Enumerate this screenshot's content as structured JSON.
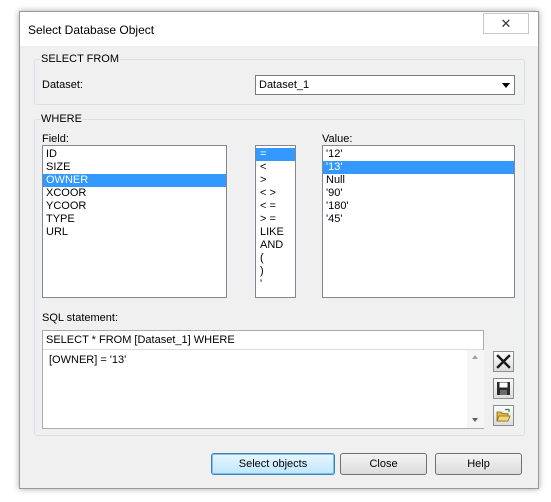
{
  "window": {
    "title": "Select Database Object",
    "close_glyph": "✕"
  },
  "select_from": {
    "group_label": "SELECT FROM",
    "dataset_label": "Dataset:",
    "dataset_value": "Dataset_1"
  },
  "where": {
    "group_label": "WHERE",
    "field_label": "Field:",
    "fields": [
      "ID",
      "SIZE",
      "OWNER",
      "XCOOR",
      "YCOOR",
      "TYPE",
      "URL"
    ],
    "selected_field": "OWNER",
    "operators": [
      "=",
      "<",
      ">",
      "< >",
      "< =",
      "> =",
      "LIKE",
      "AND",
      "(",
      ")",
      "'"
    ],
    "selected_operator": "=",
    "value_label": "Value:",
    "values": [
      "'12'",
      "'13'",
      "Null",
      "'90'",
      "'180'",
      "'45'"
    ],
    "selected_value": "'13'"
  },
  "sql": {
    "label": "SQL statement:",
    "header": "SELECT * FROM [Dataset_1] WHERE",
    "body": "[OWNER] = '13'"
  },
  "buttons": {
    "select_objects": "Select objects",
    "close": "Close",
    "help": "Help"
  }
}
